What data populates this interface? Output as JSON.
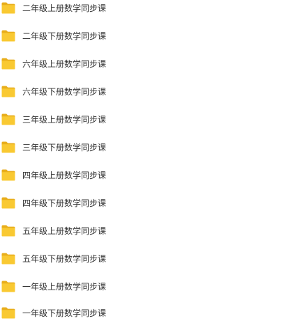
{
  "folders": [
    {
      "name": "二年级上册数学同步课",
      "icon": "folder-icon"
    },
    {
      "name": "二年级下册数学同步课",
      "icon": "folder-icon"
    },
    {
      "name": "六年级上册数学同步课",
      "icon": "folder-icon"
    },
    {
      "name": "六年级下册数学同步课",
      "icon": "folder-icon"
    },
    {
      "name": "三年级上册数学同步课",
      "icon": "folder-icon"
    },
    {
      "name": "三年级下册数学同步课",
      "icon": "folder-icon"
    },
    {
      "name": "四年级上册数学同步课",
      "icon": "folder-icon"
    },
    {
      "name": "四年级下册数学同步课",
      "icon": "folder-icon"
    },
    {
      "name": "五年级上册数学同步课",
      "icon": "folder-icon"
    },
    {
      "name": "五年级下册数学同步课",
      "icon": "folder-icon"
    },
    {
      "name": "一年级上册数学同步课",
      "icon": "folder-icon"
    },
    {
      "name": "一年级下册数学同步课",
      "icon": "folder-icon"
    }
  ],
  "colors": {
    "folder_front": "#F9C932",
    "folder_back": "#E8AE1C",
    "text": "#333333"
  }
}
